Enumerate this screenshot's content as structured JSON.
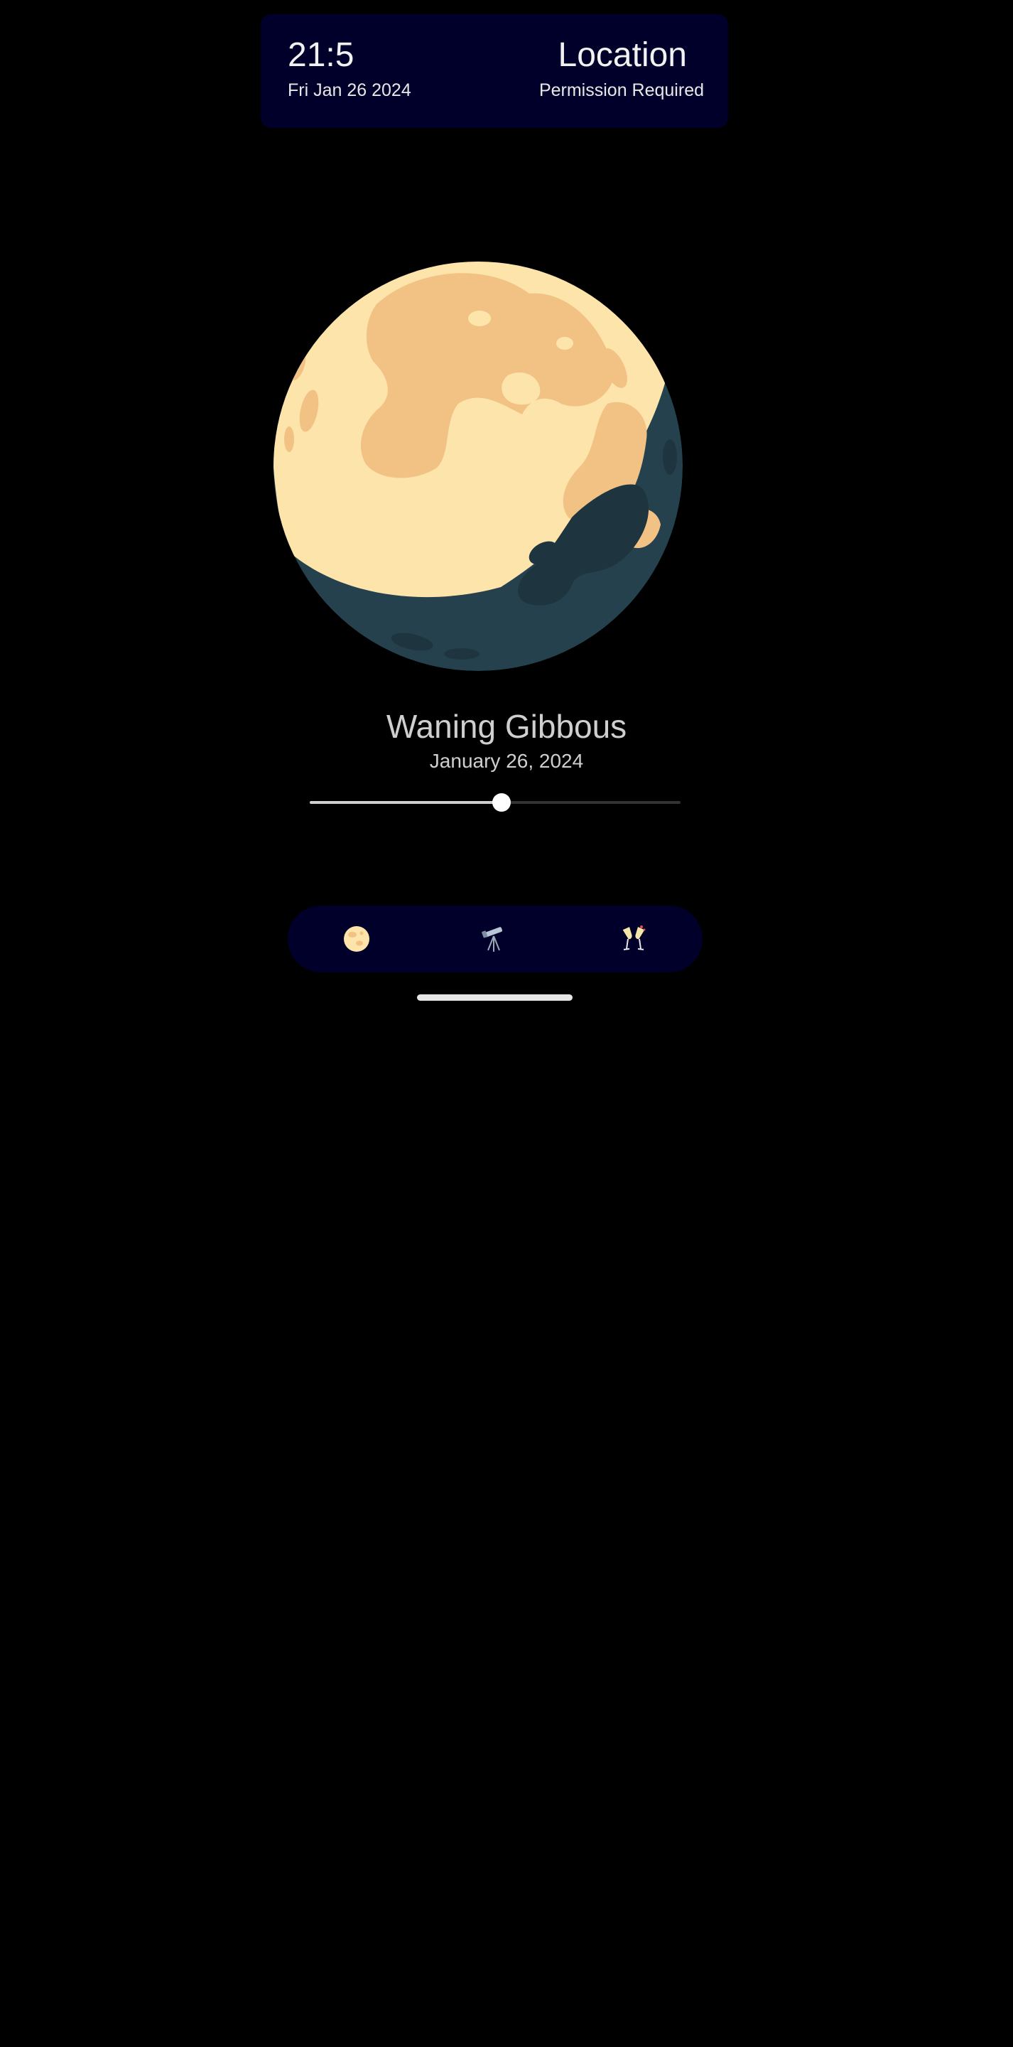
{
  "status_card": {
    "time": "21:5",
    "date": "Fri Jan 26 2024",
    "location_title": "Location",
    "location_status": "Permission Required"
  },
  "moon": {
    "phase_name": "Waning Gibbous",
    "phase_date": "January 26, 2024",
    "lit_color": "#fde4ab",
    "maria_color": "#f1c283",
    "shadow_color": "#25414d"
  },
  "slider": {
    "value": 0.517
  },
  "nav": {
    "items": [
      {
        "icon": "moon-icon"
      },
      {
        "icon": "telescope-icon"
      },
      {
        "icon": "champagne-glasses-icon"
      }
    ],
    "background": "#00002a"
  }
}
